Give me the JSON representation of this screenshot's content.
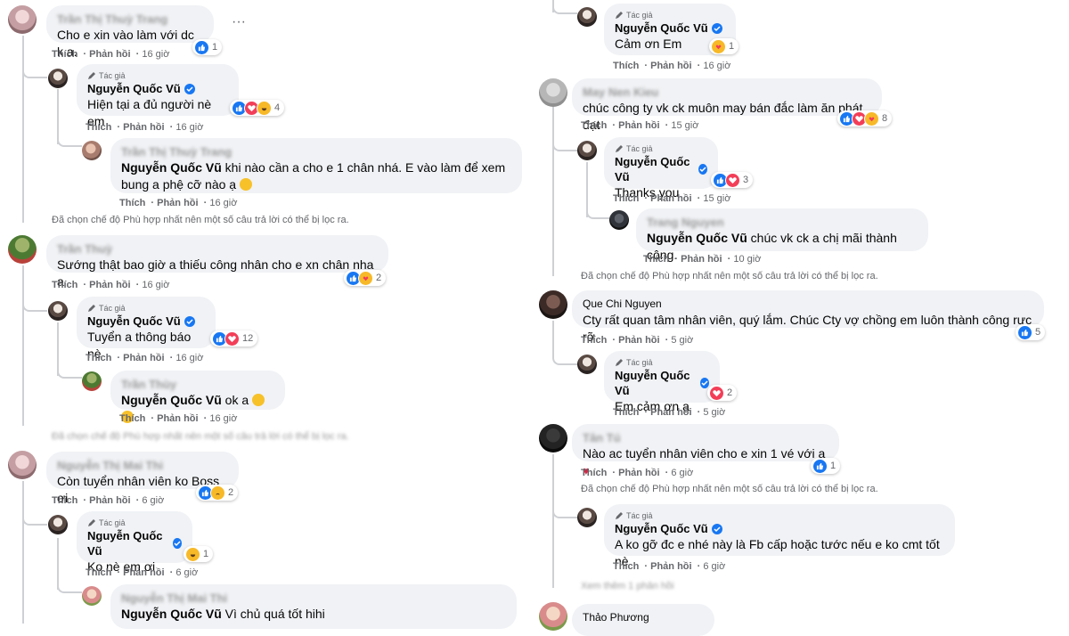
{
  "labels": {
    "author_tag": "Tác giả",
    "like": "Thích",
    "reply": "Phản hồi",
    "filter_note": "Đã chọn chế độ Phù hợp nhất nên một số câu trả lời có thể bị lọc ra."
  },
  "left": {
    "c1": {
      "name": "Trần Thị Thuỳ Trang",
      "text": "Cho e xin vào làm với dc k a.",
      "time": "16 giờ",
      "reaction_count": "1"
    },
    "r1": {
      "name": "Nguyễn Quốc Vũ",
      "text": "Hiện tại a đủ người nè em",
      "time": "16 giờ",
      "reaction_count": "4"
    },
    "r1a": {
      "name": "Trần Thị Thuỳ Trang",
      "mention": "Nguyễn Quốc Vũ",
      "text": " khi nào cần a cho e 1 chân nhá. E vào làm để xem",
      "text2": "bung a phệ cỡ nào ạ",
      "time": "16 giờ"
    },
    "c2": {
      "name": "Trần Thuỳ",
      "text": "Sướng thật bao giờ a thiếu công nhân cho e xn chân nha a",
      "time": "16 giờ",
      "reaction_count": "2"
    },
    "r2": {
      "name": "Nguyễn Quốc Vũ",
      "text": "Tuyển a thông báo nè",
      "time": "16 giờ",
      "reaction_count": "12"
    },
    "r2a": {
      "name": "Trần Thùy",
      "mention": "Nguyễn Quốc Vũ",
      "text": " ok a",
      "time": "16 giờ"
    },
    "c3": {
      "name": "Nguyễn Thị Mai Thi",
      "text": "Còn tuyển nhân viên ko Boss ơi",
      "time": "6 giờ",
      "reaction_count": "2"
    },
    "r3": {
      "name": "Nguyễn Quốc Vũ",
      "text": "Ko nè em ơi",
      "time": "6 giờ",
      "reaction_count": "1"
    },
    "r3a": {
      "name": "Nguyễn Thị Mai Thi",
      "mention": "Nguyễn Quốc Vũ",
      "text": " Vì chủ quá tốt hihi"
    }
  },
  "right": {
    "r0": {
      "name": "Nguyễn Quốc Vũ",
      "text": "Cảm ơn Em",
      "time": "16 giờ",
      "reaction_count": "1"
    },
    "c4": {
      "name": "May Nen Kieu",
      "text": "chúc công ty vk ck muôn may bán đắc làm ăn phát đạt",
      "time": "15 giờ",
      "reaction_count": "8"
    },
    "r4": {
      "name": "Nguyễn Quốc Vũ",
      "text": "Thanks you",
      "time": "15 giờ",
      "reaction_count": "3"
    },
    "r4a": {
      "name": "Trang Nguyen",
      "mention": "Nguyễn Quốc Vũ",
      "text": " chúc vk ck a chị mãi thành công.",
      "time": "10 giờ"
    },
    "c5": {
      "name": "Que Chi Nguyen",
      "text": "Cty rất quan tâm nhân viên, quý lắm. Chúc Cty vợ chồng em luôn thành công rực rỡ",
      "time": "5 giờ",
      "reaction_count": "5"
    },
    "r5": {
      "name": "Nguyễn Quốc Vũ",
      "text": "Em cảm ơn ạ",
      "time": "5 giờ",
      "reaction_count": "2"
    },
    "c6": {
      "name": "Tân Tú",
      "text": "Nào ac tuyển nhân viên cho e xin 1 vé với ạ",
      "time": "6 giờ",
      "reaction_count": "1"
    },
    "r6": {
      "name": "Nguyễn Quốc Vũ",
      "text": "A ko gỡ đc e nhé này là Fb cấp hoặc tước nếu e ko cmt tốt nè",
      "time": "6 giờ"
    },
    "more_replies": "Xem thêm 1 phản hồi",
    "c7": {
      "name": "Thảo Phương"
    }
  },
  "colors": {
    "like": "#1877f2",
    "love": "#f33e58",
    "haha": "#f7b928",
    "bubble": "#f0f2f5",
    "meta": "#65676b"
  }
}
